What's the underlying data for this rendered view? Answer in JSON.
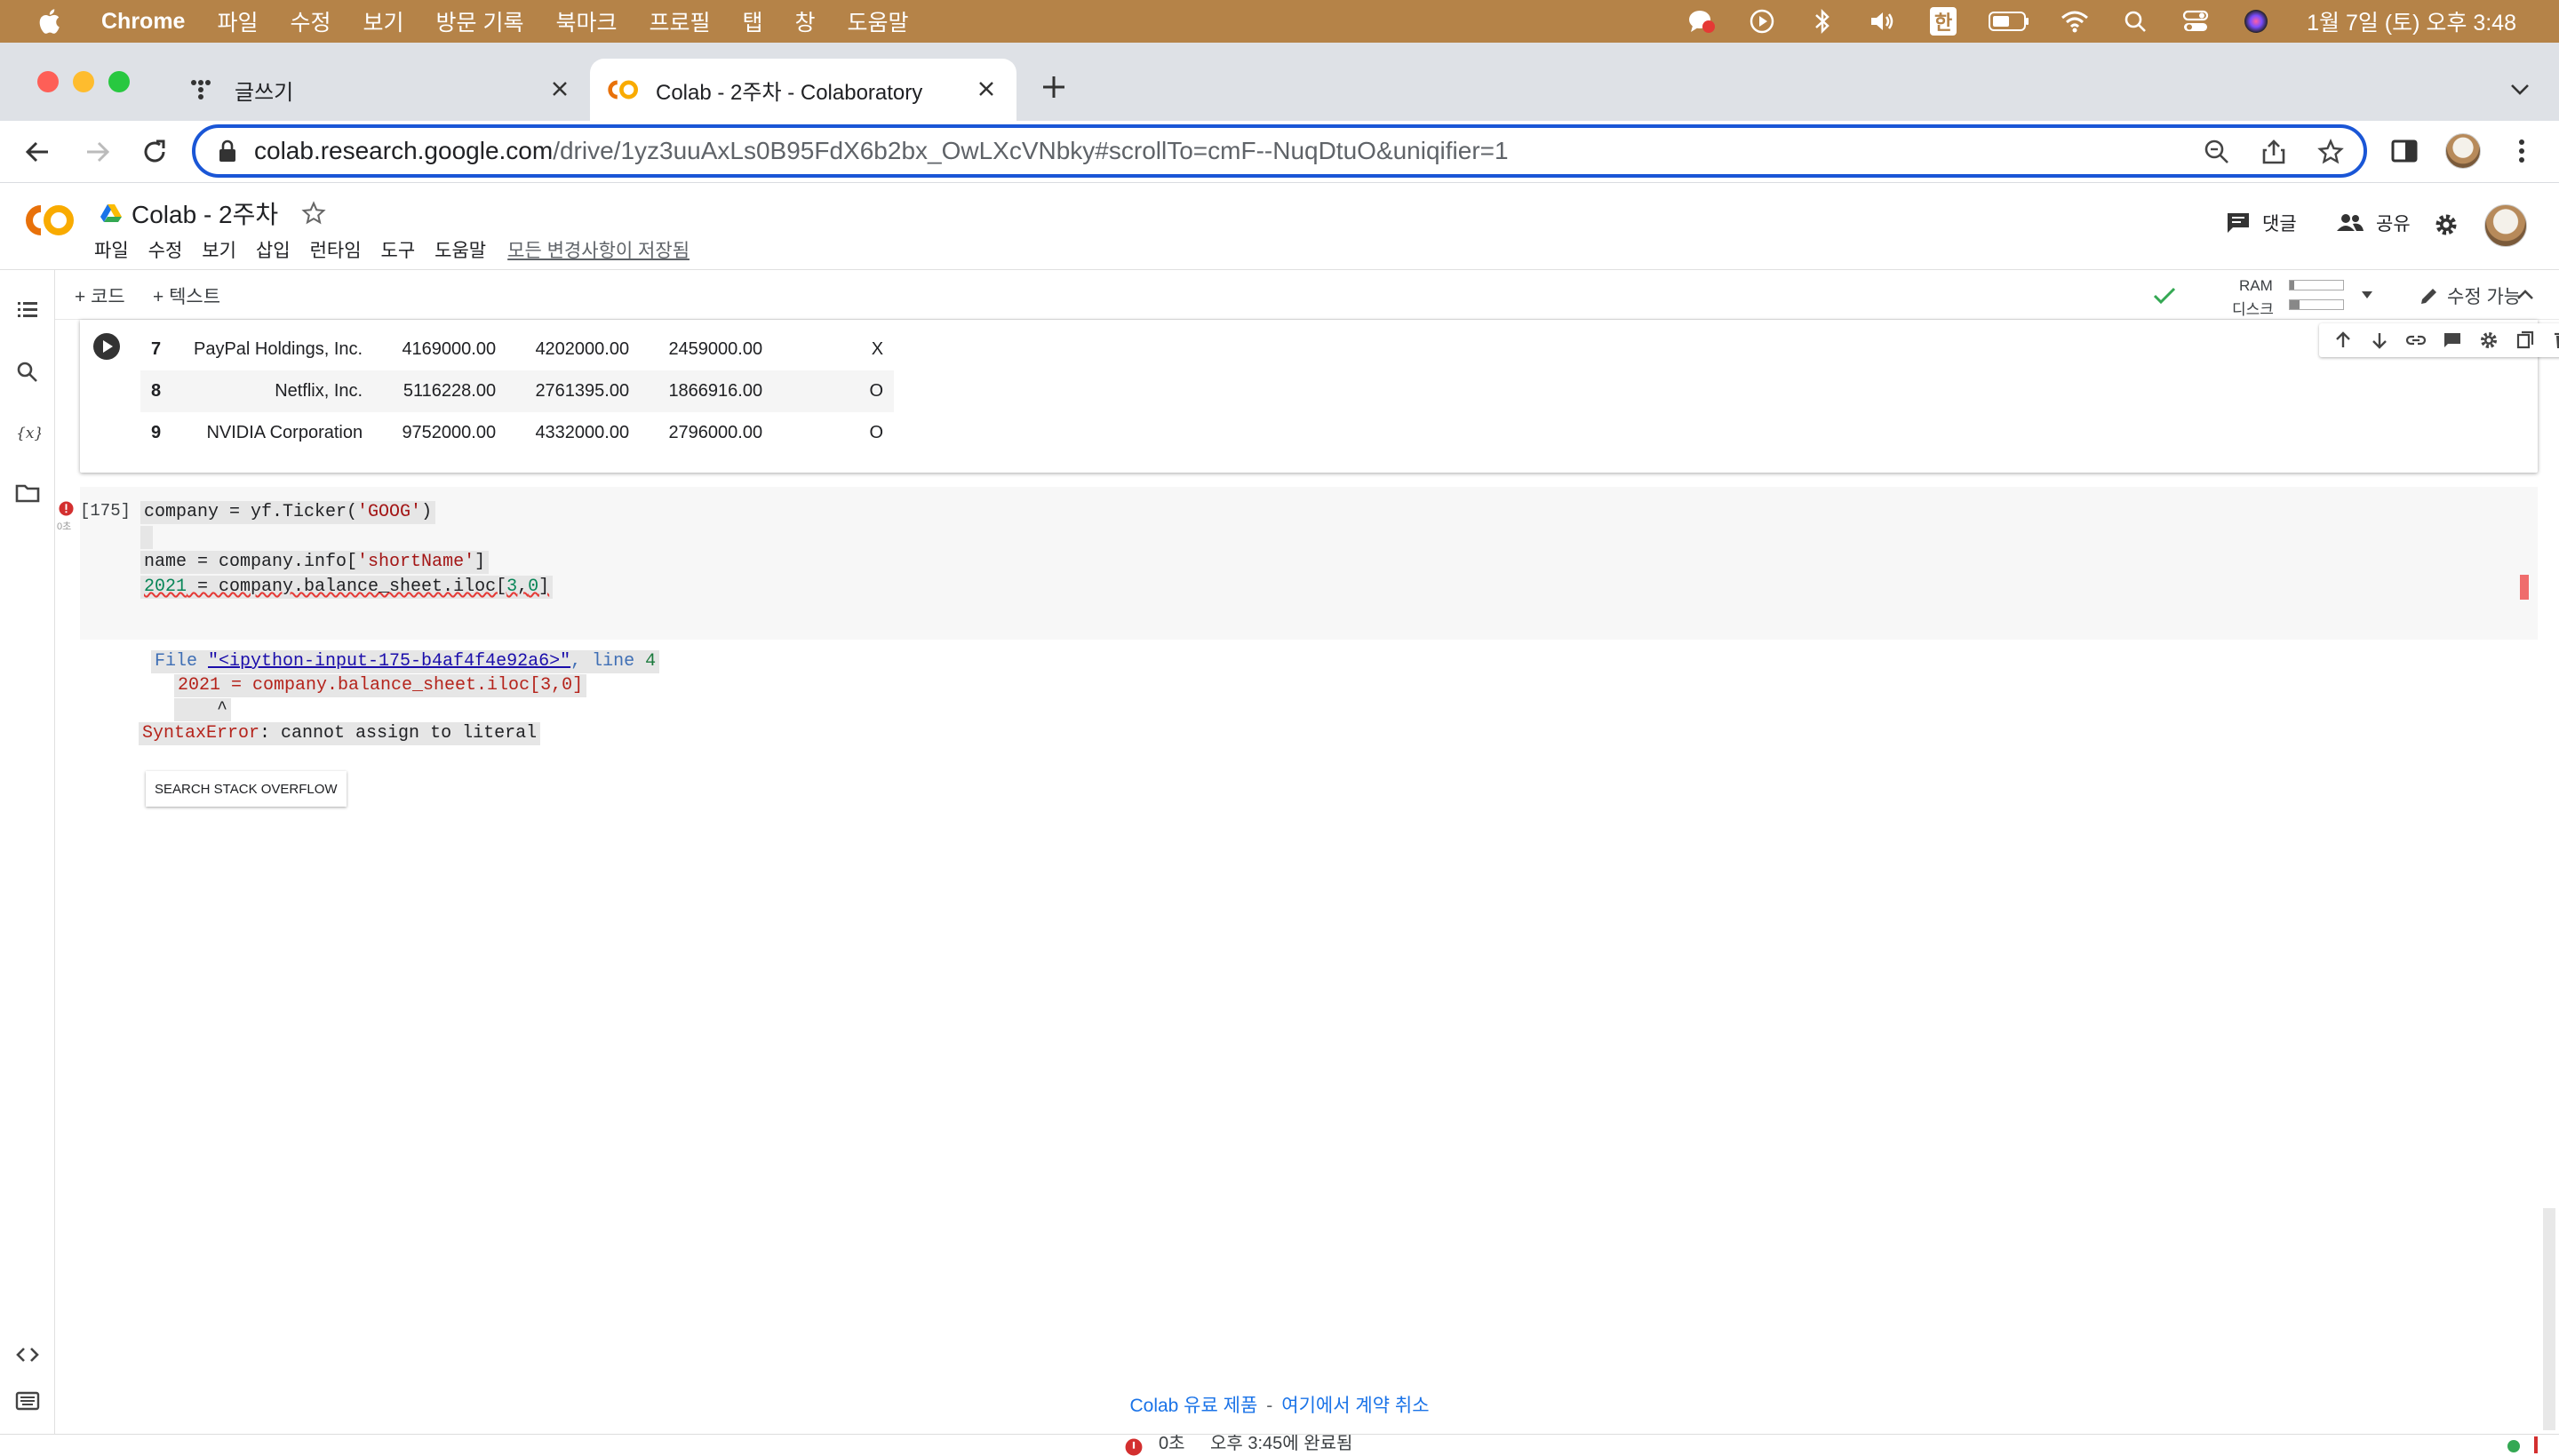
{
  "menubar": {
    "app": "Chrome",
    "items": [
      "파일",
      "수정",
      "보기",
      "방문 기록",
      "북마크",
      "프로필",
      "탭",
      "창",
      "도움말"
    ],
    "input_method": "한",
    "clock": "1월 7일 (토) 오후 3:48"
  },
  "tabs": [
    {
      "title": "글쓰기",
      "active": false
    },
    {
      "title": "Colab - 2주차 - Colaboratory",
      "active": true
    }
  ],
  "address": {
    "host": "colab.research.google.com",
    "path": "/drive/1yz3uuAxLs0B95FdX6b2bx_OwLXcVNbky#scrollTo=cmF--NuqDtuO&uniqifier=1"
  },
  "colab": {
    "doc_title": "Colab - 2주차",
    "menu": [
      "파일",
      "수정",
      "보기",
      "삽입",
      "런타임",
      "도구",
      "도움말"
    ],
    "saved_status": "모든 변경사항이 저장됨",
    "comment_label": "댓글",
    "share_label": "공유",
    "add_code": "+ 코드",
    "add_text": "+ 텍스트",
    "ram_label": "RAM",
    "disk_label": "디스크",
    "ram_level": 0.08,
    "disk_level": 0.18,
    "editable_label": "수정 가능"
  },
  "table": {
    "rows": [
      {
        "idx": "7",
        "name": "PayPal Holdings, Inc.",
        "v1": "4169000.00",
        "v2": "4202000.00",
        "v3": "2459000.00",
        "flag": "X"
      },
      {
        "idx": "8",
        "name": "Netflix, Inc.",
        "v1": "5116228.00",
        "v2": "2761395.00",
        "v3": "1866916.00",
        "flag": "O"
      },
      {
        "idx": "9",
        "name": "NVIDIA Corporation",
        "v1": "9752000.00",
        "v2": "4332000.00",
        "v3": "2796000.00",
        "flag": "O"
      }
    ]
  },
  "cell": {
    "exec_count": "[175]",
    "duration": "0초",
    "line1_a": "company = yf.Ticker(",
    "line1_str": "'GOOG'",
    "line1_b": ")",
    "line3_a": "name = company.info[",
    "line3_str": "'shortName'",
    "line3_b": "]",
    "line4_num": "2021",
    "line4_a": " = company.balance_sheet.iloc[",
    "line4_n1": "3",
    "line4_c": ",",
    "line4_n2": "0",
    "line4_d": "]"
  },
  "error": {
    "file_kw": "File ",
    "file_link": "\"<ipython-input-175-b4af4f4e92a6>\"",
    "line_kw": ", line ",
    "line_no": "4",
    "code_line": "2021 = company.balance_sheet.iloc[3,0]",
    "caret": "^",
    "err_type": "SyntaxError",
    "err_msg": ": cannot assign to literal",
    "search_button": "SEARCH STACK OVERFLOW"
  },
  "footer": {
    "link1": "Colab 유료 제품",
    "sep": "-",
    "link2": "여기에서 계약 취소"
  },
  "status": {
    "duration": "0초",
    "completed": "오후 3:45에 완료됨"
  },
  "colors": {
    "menubar_bg": "#b58348",
    "accent_blue": "#1a56d6",
    "colab_orange": "#f9ab00",
    "error_red": "#d32f2f"
  }
}
